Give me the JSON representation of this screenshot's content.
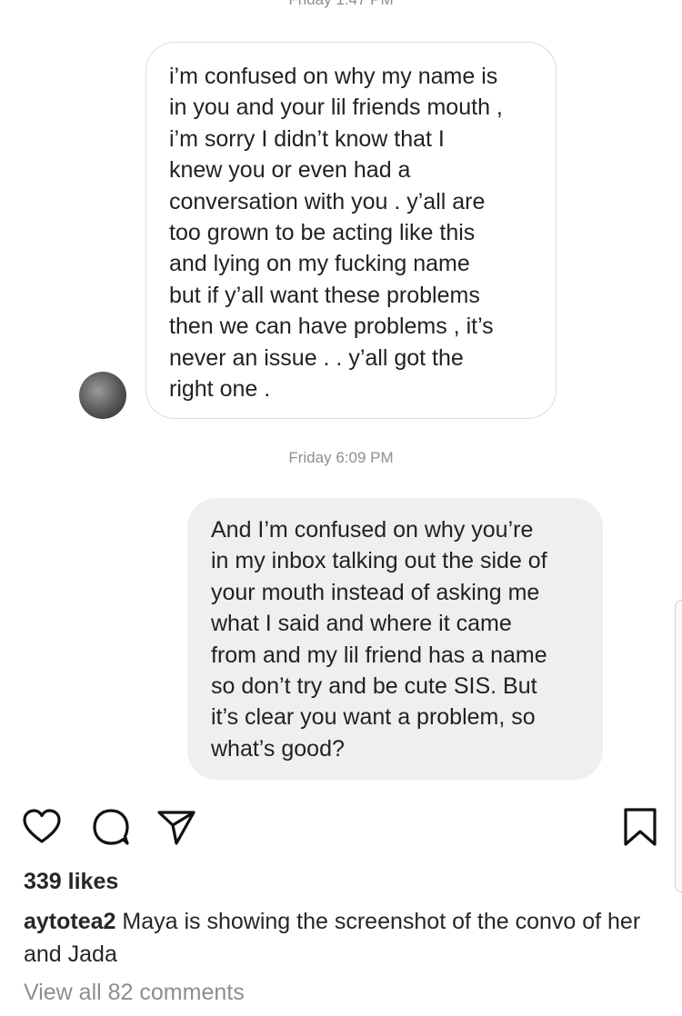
{
  "messages": {
    "timestamp_top": "Friday 1:47 PM",
    "incoming_text": "i’m confused on why my name is\nin you and your lil friends mouth ,\ni’m sorry I didn’t know that I\nknew you or even had a\nconversation with you . y’all are\ntoo grown to be acting like this\nand lying on my fucking name\nbut if y’all want these problems\nthen we can have problems , it’s\nnever an issue . . y’all got the\nright one .",
    "timestamp_mid": "Friday 6:09 PM",
    "outgoing_text": "And I’m confused on why you’re\nin my inbox talking out the side of\nyour mouth instead of asking me\nwhat I said and where it came\nfrom and my lil friend has a name\nso don’t try and be cute SIS. But\nit’s clear you want a problem, so\nwhat’s good?"
  },
  "post": {
    "likes": "339 likes",
    "caption_user": "aytotea2",
    "caption_text": " Maya is showing the screenshot of the convo of her and Jada",
    "view_comments": "View all 82 comments"
  },
  "icons": {
    "like": "heart-outline-icon",
    "comment": "comment-bubble-icon",
    "share": "paper-plane-icon",
    "save": "bookmark-outline-icon"
  }
}
